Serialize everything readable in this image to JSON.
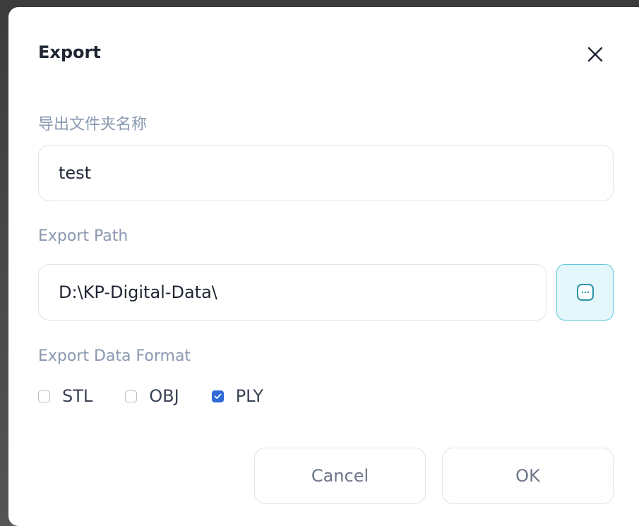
{
  "dialog": {
    "title": "Export",
    "close_icon": "close-icon"
  },
  "folder_name": {
    "label": "导出文件夹名称",
    "value": "test"
  },
  "export_path": {
    "label": "Export Path",
    "value": "D:\\KP-Digital-Data\\",
    "browse_icon": "more-dots-icon"
  },
  "format": {
    "label": "Export Data Format",
    "options": [
      {
        "label": "STL",
        "checked": false
      },
      {
        "label": "OBJ",
        "checked": false
      },
      {
        "label": "PLY",
        "checked": true
      }
    ]
  },
  "buttons": {
    "cancel": "Cancel",
    "ok": "OK"
  },
  "colors": {
    "accent": "#2f6bd8",
    "browse_border": "#5cc8d8",
    "browse_bg": "#e4f7fb",
    "label": "#8a98b0"
  }
}
